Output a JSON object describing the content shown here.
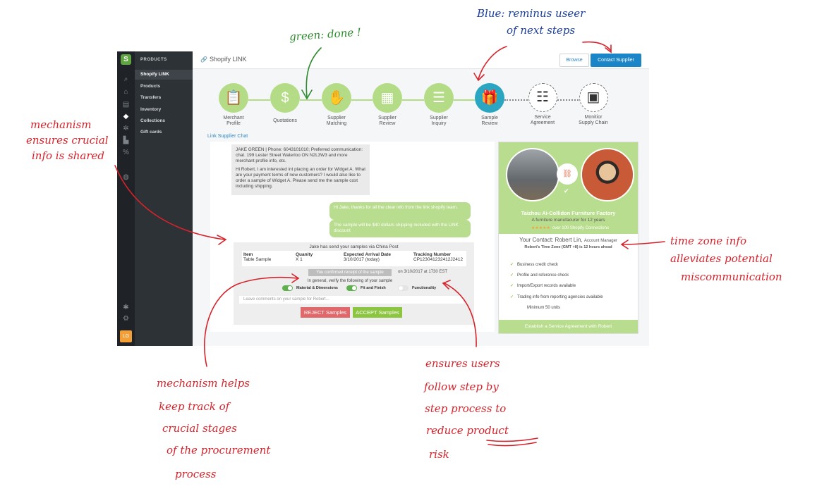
{
  "sidebar": {
    "logo": "S",
    "header": "PRODUCTS",
    "items": [
      {
        "label": "Shopify LINK",
        "active": true
      },
      {
        "label": "Products"
      },
      {
        "label": "Transfers"
      },
      {
        "label": "Inventory"
      },
      {
        "label": "Collections"
      },
      {
        "label": "Gift cards"
      }
    ],
    "avatar": "LG"
  },
  "header": {
    "title": "Shopify LINK",
    "browse_label": "Browse",
    "contact_label": "Contact Supplier"
  },
  "steps": [
    {
      "label1": "Merchant",
      "label2": "Profile",
      "icon": "clipboard-icon",
      "status": "done"
    },
    {
      "label1": "Quotations",
      "label2": "",
      "icon": "money-icon",
      "status": "done"
    },
    {
      "label1": "Supplier",
      "label2": "Matching",
      "icon": "handshake-icon",
      "status": "done"
    },
    {
      "label1": "Supplier",
      "label2": "Review",
      "icon": "document-icon",
      "status": "done"
    },
    {
      "label1": "Supplier",
      "label2": "Inquiry",
      "icon": "chat-icon",
      "status": "done"
    },
    {
      "label1": "Sample",
      "label2": "Review",
      "icon": "gift-icon",
      "status": "current"
    },
    {
      "label1": "Service",
      "label2": "Agreement",
      "icon": "agreement-icon",
      "status": "pending"
    },
    {
      "label1": "Monitior",
      "label2": "Supply Chain",
      "icon": "boxes-icon",
      "status": "pending"
    }
  ],
  "chat": {
    "title": "Link Supplier Chat",
    "msg1": "JAKE  GREEN | Phone: 6043101010; Preferred communication: chat. 199 Lester Street Waterloo ON N2L3W3 and more merchant profile info, etc.",
    "msg2": "Hi Robert, I am interested int placing an order for Widget A. What are your payment terms of new customers? I would also like to order a sample of Widget A. Please send me the sample cost including shipping.",
    "reply1": "Hi Jake, thanks for all the clear info from the link shopify team.",
    "reply2": "The sample will be $40 dollars shipping included with the LINK discount"
  },
  "sample": {
    "heading": "Jake has send your samples via China Post",
    "columns": [
      "Item",
      "Quanity",
      "Expected Arrival Date",
      "Tracking Number"
    ],
    "values": [
      "Table Sample",
      "X 1",
      "3/10/2017 (today)",
      "CP123041232412J2412"
    ],
    "confirm": "You confirmed receipt of the sample",
    "confirm_date": "on 3/10/2017 at 1730 EST",
    "verify": "In general, verify the following of your sample",
    "toggles": [
      {
        "label": "Material & Dimensions",
        "on": true
      },
      {
        "label": "Fit and Finish",
        "on": true
      },
      {
        "label": "Functionality",
        "on": false
      }
    ],
    "comments_placeholder": "Leave comments on your sample for Robert...",
    "reject_label": "REJECT Samples",
    "accept_label": "ACCEPT Samples"
  },
  "supplier": {
    "name": "Taizhou Ai-Collidon Furniture Factory",
    "desc": "A furniture manufacurer for 12 years",
    "stars": "★★★★★",
    "stars_note": "over 100 Shopify Connections",
    "contact": "Your Contact: Robert Lin,",
    "contact_role": "Account Manager",
    "timezone": "Robert's Time Zone (GMT +8) is 12 hours ahead",
    "checks": [
      "Business credit check",
      "Profile and reference check",
      "Import/Export records available",
      "Trading info from reporting agencies available"
    ],
    "minimum": "Minimum 50 units",
    "footer": "Establish a Service Agreement with Robert"
  },
  "annotations": {
    "green_note": "green: done !",
    "blue_note_1": "Blue: reminus useer",
    "blue_note_2": "of next steps",
    "left_1": "mechanism",
    "left_2": "ensures crucial",
    "left_3": "info is shared",
    "right_1": "time zone info",
    "right_2": "alleviates potential",
    "right_3": "miscommunication",
    "bl_1": "mechanism helps",
    "bl_2": "keep track of",
    "bl_3": "crucial stages",
    "bl_4": "of the procurement",
    "bl_5": "process",
    "bm_1": "ensures users",
    "bm_2": "follow step by",
    "bm_3": "step process to",
    "bm_4": "reduce product",
    "bm_5": "risk"
  }
}
